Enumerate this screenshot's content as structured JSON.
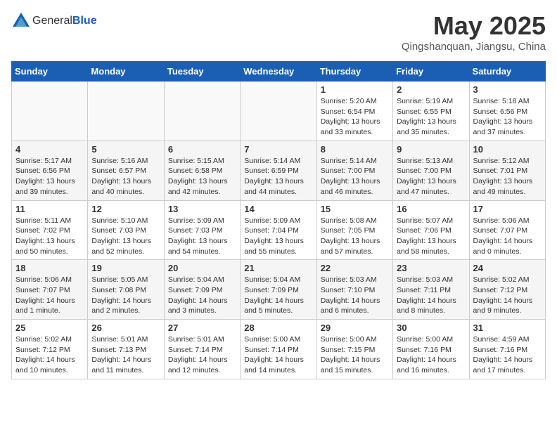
{
  "header": {
    "logo_general": "General",
    "logo_blue": "Blue",
    "month": "May 2025",
    "location": "Qingshanquan, Jiangsu, China"
  },
  "weekdays": [
    "Sunday",
    "Monday",
    "Tuesday",
    "Wednesday",
    "Thursday",
    "Friday",
    "Saturday"
  ],
  "weeks": [
    [
      {
        "day": "",
        "info": ""
      },
      {
        "day": "",
        "info": ""
      },
      {
        "day": "",
        "info": ""
      },
      {
        "day": "",
        "info": ""
      },
      {
        "day": "1",
        "info": "Sunrise: 5:20 AM\nSunset: 6:54 PM\nDaylight: 13 hours\nand 33 minutes."
      },
      {
        "day": "2",
        "info": "Sunrise: 5:19 AM\nSunset: 6:55 PM\nDaylight: 13 hours\nand 35 minutes."
      },
      {
        "day": "3",
        "info": "Sunrise: 5:18 AM\nSunset: 6:56 PM\nDaylight: 13 hours\nand 37 minutes."
      }
    ],
    [
      {
        "day": "4",
        "info": "Sunrise: 5:17 AM\nSunset: 6:56 PM\nDaylight: 13 hours\nand 39 minutes."
      },
      {
        "day": "5",
        "info": "Sunrise: 5:16 AM\nSunset: 6:57 PM\nDaylight: 13 hours\nand 40 minutes."
      },
      {
        "day": "6",
        "info": "Sunrise: 5:15 AM\nSunset: 6:58 PM\nDaylight: 13 hours\nand 42 minutes."
      },
      {
        "day": "7",
        "info": "Sunrise: 5:14 AM\nSunset: 6:59 PM\nDaylight: 13 hours\nand 44 minutes."
      },
      {
        "day": "8",
        "info": "Sunrise: 5:14 AM\nSunset: 7:00 PM\nDaylight: 13 hours\nand 46 minutes."
      },
      {
        "day": "9",
        "info": "Sunrise: 5:13 AM\nSunset: 7:00 PM\nDaylight: 13 hours\nand 47 minutes."
      },
      {
        "day": "10",
        "info": "Sunrise: 5:12 AM\nSunset: 7:01 PM\nDaylight: 13 hours\nand 49 minutes."
      }
    ],
    [
      {
        "day": "11",
        "info": "Sunrise: 5:11 AM\nSunset: 7:02 PM\nDaylight: 13 hours\nand 50 minutes."
      },
      {
        "day": "12",
        "info": "Sunrise: 5:10 AM\nSunset: 7:03 PM\nDaylight: 13 hours\nand 52 minutes."
      },
      {
        "day": "13",
        "info": "Sunrise: 5:09 AM\nSunset: 7:03 PM\nDaylight: 13 hours\nand 54 minutes."
      },
      {
        "day": "14",
        "info": "Sunrise: 5:09 AM\nSunset: 7:04 PM\nDaylight: 13 hours\nand 55 minutes."
      },
      {
        "day": "15",
        "info": "Sunrise: 5:08 AM\nSunset: 7:05 PM\nDaylight: 13 hours\nand 57 minutes."
      },
      {
        "day": "16",
        "info": "Sunrise: 5:07 AM\nSunset: 7:06 PM\nDaylight: 13 hours\nand 58 minutes."
      },
      {
        "day": "17",
        "info": "Sunrise: 5:06 AM\nSunset: 7:07 PM\nDaylight: 14 hours\nand 0 minutes."
      }
    ],
    [
      {
        "day": "18",
        "info": "Sunrise: 5:06 AM\nSunset: 7:07 PM\nDaylight: 14 hours\nand 1 minute."
      },
      {
        "day": "19",
        "info": "Sunrise: 5:05 AM\nSunset: 7:08 PM\nDaylight: 14 hours\nand 2 minutes."
      },
      {
        "day": "20",
        "info": "Sunrise: 5:04 AM\nSunset: 7:09 PM\nDaylight: 14 hours\nand 3 minutes."
      },
      {
        "day": "21",
        "info": "Sunrise: 5:04 AM\nSunset: 7:09 PM\nDaylight: 14 hours\nand 5 minutes."
      },
      {
        "day": "22",
        "info": "Sunrise: 5:03 AM\nSunset: 7:10 PM\nDaylight: 14 hours\nand 6 minutes."
      },
      {
        "day": "23",
        "info": "Sunrise: 5:03 AM\nSunset: 7:11 PM\nDaylight: 14 hours\nand 8 minutes."
      },
      {
        "day": "24",
        "info": "Sunrise: 5:02 AM\nSunset: 7:12 PM\nDaylight: 14 hours\nand 9 minutes."
      }
    ],
    [
      {
        "day": "25",
        "info": "Sunrise: 5:02 AM\nSunset: 7:12 PM\nDaylight: 14 hours\nand 10 minutes."
      },
      {
        "day": "26",
        "info": "Sunrise: 5:01 AM\nSunset: 7:13 PM\nDaylight: 14 hours\nand 11 minutes."
      },
      {
        "day": "27",
        "info": "Sunrise: 5:01 AM\nSunset: 7:14 PM\nDaylight: 14 hours\nand 12 minutes."
      },
      {
        "day": "28",
        "info": "Sunrise: 5:00 AM\nSunset: 7:14 PM\nDaylight: 14 hours\nand 14 minutes."
      },
      {
        "day": "29",
        "info": "Sunrise: 5:00 AM\nSunset: 7:15 PM\nDaylight: 14 hours\nand 15 minutes."
      },
      {
        "day": "30",
        "info": "Sunrise: 5:00 AM\nSunset: 7:16 PM\nDaylight: 14 hours\nand 16 minutes."
      },
      {
        "day": "31",
        "info": "Sunrise: 4:59 AM\nSunset: 7:16 PM\nDaylight: 14 hours\nand 17 minutes."
      }
    ]
  ]
}
